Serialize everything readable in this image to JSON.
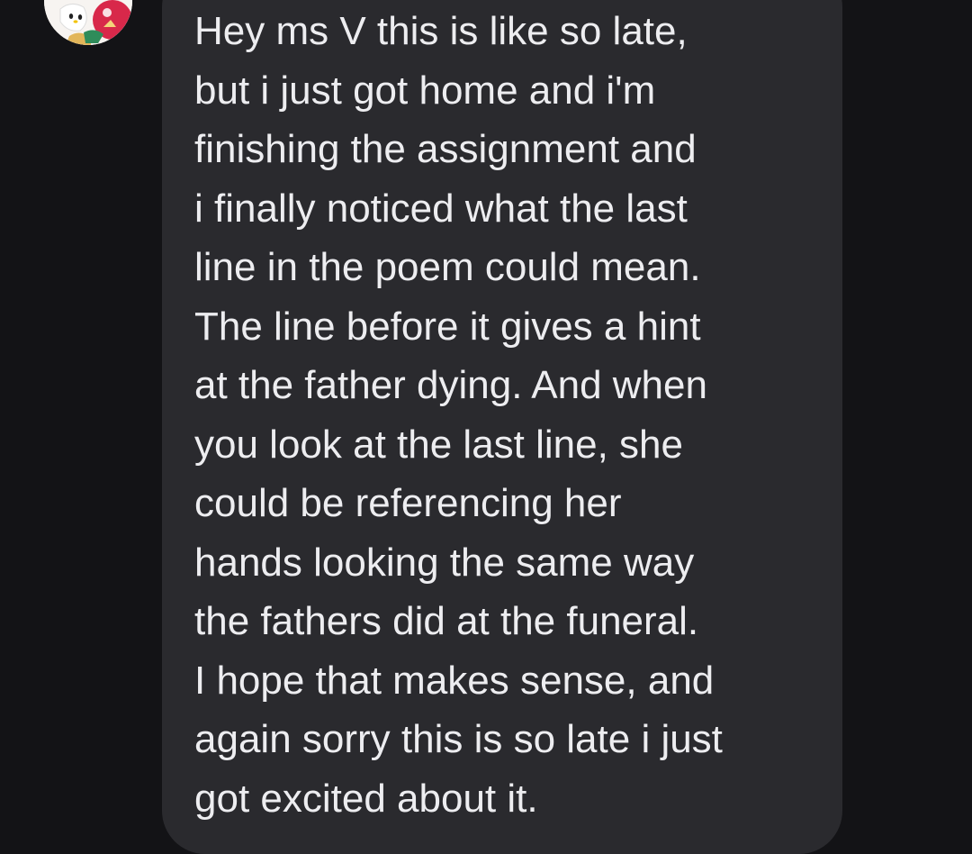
{
  "conversation": {
    "message": {
      "sender_avatar_icon": "hello-kitty-avatar-icon",
      "lines": [
        "Hey ms V this is like so late,",
        "but i just got home and i'm",
        "finishing the assignment and",
        "i finally noticed what the last",
        "line in the poem could mean.",
        "The line before it gives a hint",
        "at the father dying. And when",
        "you look at the last line, she",
        "could be referencing her",
        "hands looking the same way",
        "the fathers did at the funeral.",
        "I hope that makes sense, and",
        "again sorry this is so late i just",
        "got excited about it."
      ]
    }
  },
  "colors": {
    "background": "#131316",
    "bubble": "#2a2a2e",
    "text": "#ededf0"
  }
}
